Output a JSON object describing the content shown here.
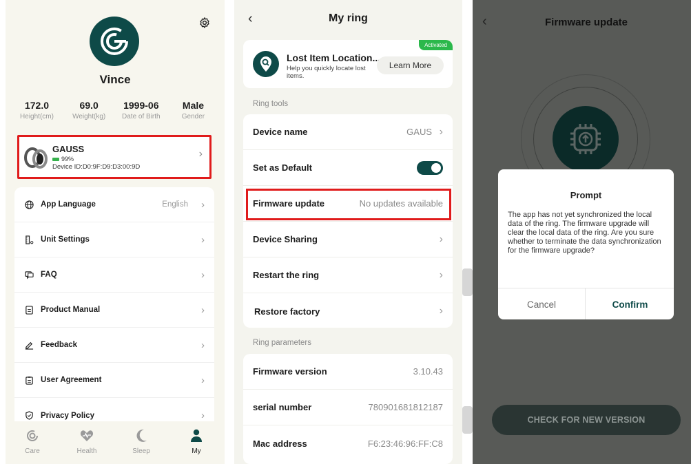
{
  "profile": {
    "name": "Vince",
    "stats": [
      {
        "value": "172.0",
        "label": "Height(cm)"
      },
      {
        "value": "69.0",
        "label": "Weight(kg)"
      },
      {
        "value": "1999-06",
        "label": "Date of Birth"
      },
      {
        "value": "Male",
        "label": "Gender"
      }
    ],
    "device": {
      "name": "GAUSS",
      "battery": "99%",
      "id": "Device ID:D0:9F:D9:D3:00:9D"
    },
    "menu": [
      {
        "label": "App Language",
        "value": "English",
        "icon": "globe-icon"
      },
      {
        "label": "Unit Settings",
        "value": "",
        "icon": "ruler-icon"
      },
      {
        "label": "FAQ",
        "value": "",
        "icon": "chat-icon"
      },
      {
        "label": "Product Manual",
        "value": "",
        "icon": "document-icon"
      },
      {
        "label": "Feedback",
        "value": "",
        "icon": "pencil-icon"
      },
      {
        "label": "User Agreement",
        "value": "",
        "icon": "clipboard-icon"
      },
      {
        "label": "Privacy Policy",
        "value": "",
        "icon": "shield-icon"
      }
    ],
    "tabs": [
      {
        "label": "Care",
        "icon": "care-icon"
      },
      {
        "label": "Health",
        "icon": "heart-icon"
      },
      {
        "label": "Sleep",
        "icon": "moon-icon"
      },
      {
        "label": "My",
        "icon": "person-icon",
        "active": true
      }
    ]
  },
  "ring": {
    "title": "My ring",
    "lost_item": {
      "title": "Lost Item Location...",
      "subtitle": "Help you quickly locate lost items.",
      "button": "Learn More",
      "badge": "Activated"
    },
    "tools_label": "Ring tools",
    "tools": [
      {
        "label": "Device name",
        "value": "GAUS"
      },
      {
        "label": "Set as Default",
        "value": "",
        "toggle": true
      },
      {
        "label": "Firmware update",
        "value": "No updates available"
      },
      {
        "label": "Device Sharing",
        "value": ""
      },
      {
        "label": "Restart the ring",
        "value": ""
      },
      {
        "label": "Restore factory",
        "value": ""
      }
    ],
    "params_label": "Ring parameters",
    "params": [
      {
        "label": "Firmware version",
        "value": "3.10.43"
      },
      {
        "label": "serial number",
        "value": "780901681812187"
      },
      {
        "label": "Mac address",
        "value": "F6:23:46:96:FF:C8"
      }
    ]
  },
  "firmware": {
    "title": "Firmware update",
    "dialog": {
      "title": "Prompt",
      "body": "The app has not yet synchronized the local data of the ring. The firmware upgrade will clear the local data of the ring. Are you sure whether to terminate the data synchronization for the firmware upgrade?",
      "cancel": "Cancel",
      "confirm": "Confirm"
    },
    "check_button": "CHECK FOR NEW VERSION"
  },
  "colors": {
    "brand": "#0e4a48",
    "highlight": "#e01b1b",
    "badge": "#2bb84b"
  }
}
